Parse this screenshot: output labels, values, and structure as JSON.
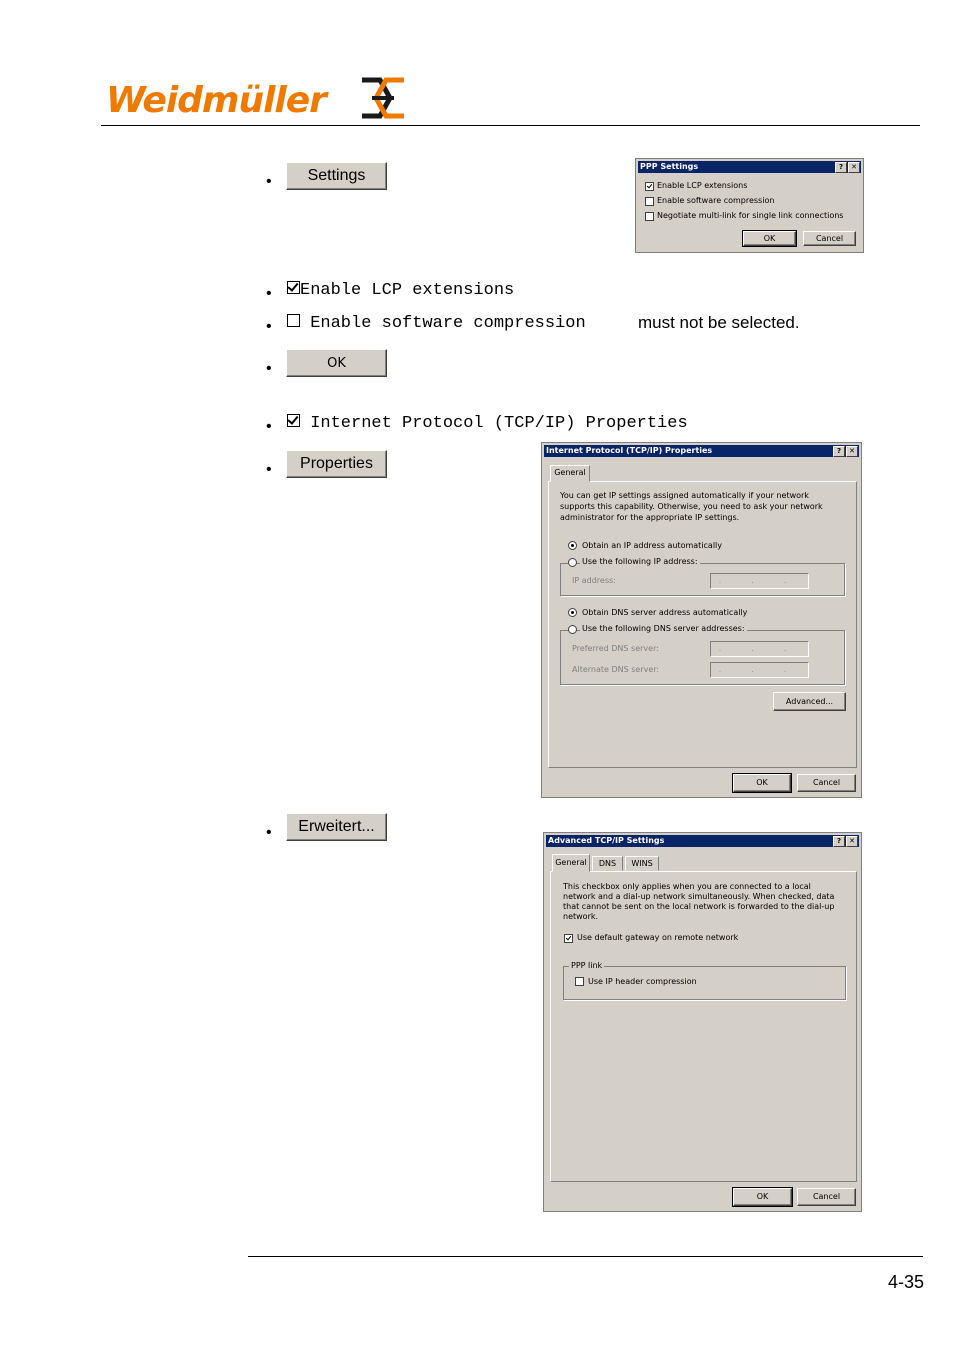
{
  "header": {
    "brand": "Weidmüller",
    "brand_color": "#f07a00"
  },
  "steps": {
    "settings_button": "Settings",
    "enable_lcp": "Enable LCP extensions",
    "enable_sw_compression": "Enable software compression",
    "must_not": "must not be selected.",
    "ok_button": "OK",
    "tcpip_props": "Internet Protocol (TCP/IP) Properties",
    "properties_button": "Properties",
    "erweitert_button": "Erweitert..."
  },
  "ppp_dialog": {
    "title": "PPP Settings",
    "help": "?",
    "close": "✕",
    "options": [
      "Enable LCP extensions",
      "Enable software compression",
      "Negotiate multi-link for single link connections"
    ],
    "ok": "OK",
    "cancel": "Cancel"
  },
  "tcpip_dialog": {
    "title": "Internet Protocol (TCP/IP) Properties",
    "help": "?",
    "close": "✕",
    "tab": "General",
    "intro": [
      "You can get IP settings assigned automatically if your network",
      "supports this capability. Otherwise, you need to ask your network",
      "administrator for the appropriate IP settings."
    ],
    "obtain_ip": "Obtain an IP address automatically",
    "use_ip": "Use the following IP address:",
    "ip_address": "IP address:",
    "obtain_dns": "Obtain DNS server address automatically",
    "use_dns": "Use the following DNS server addresses:",
    "preferred_dns": "Preferred DNS server:",
    "alternate_dns": "Alternate DNS server:",
    "ip_placeholder": ". . .",
    "advanced": "Advanced...",
    "ok": "OK",
    "cancel": "Cancel"
  },
  "advanced_dialog": {
    "title": "Advanced TCP/IP Settings",
    "help": "?",
    "close": "✕",
    "tabs": [
      "General",
      "DNS",
      "WINS"
    ],
    "info": [
      "This checkbox only applies when you are connected to a local",
      "network and a dial-up network simultaneously.  When checked, data",
      "that cannot be sent on the local network is forwarded to the dial-up",
      "network."
    ],
    "default_gateway": "Use default gateway on remote network",
    "ppp_link": "PPP link",
    "ip_header_compression": "Use IP header compression",
    "ok": "OK",
    "cancel": "Cancel"
  },
  "footer": {
    "page_number": "4-35"
  }
}
